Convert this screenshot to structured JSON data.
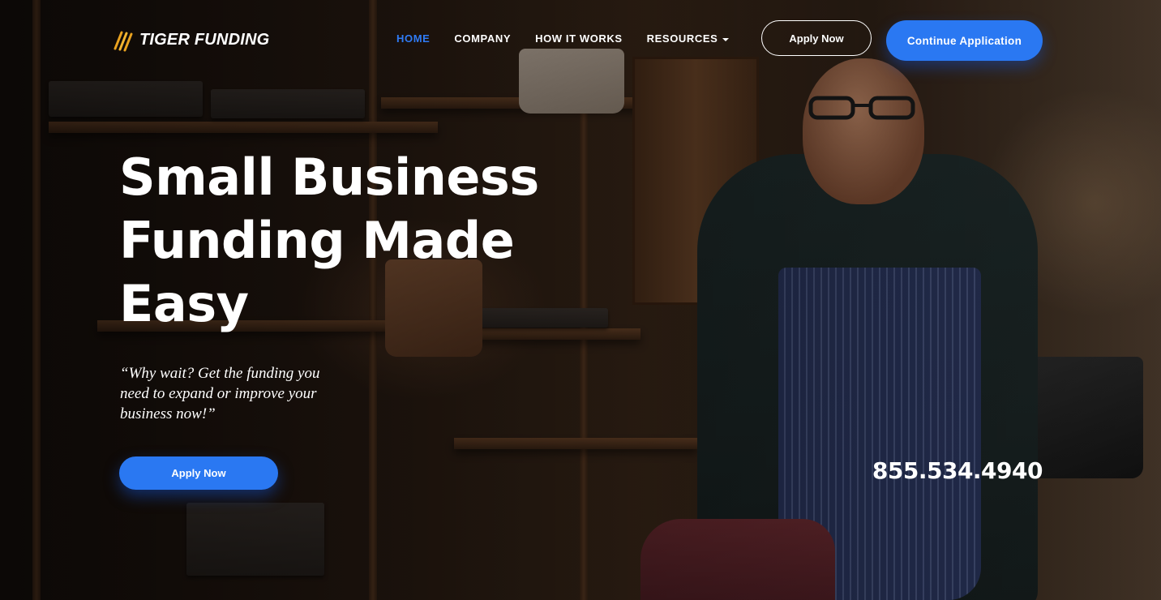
{
  "brand": {
    "name": "TIGER FUNDING",
    "accent": "#2a78f2",
    "logo_icon": "claw-marks-icon"
  },
  "nav": {
    "items": [
      {
        "label": "HOME",
        "active": true
      },
      {
        "label": "COMPANY",
        "active": false
      },
      {
        "label": "HOW IT WORKS",
        "active": false
      },
      {
        "label": "RESOURCES",
        "active": false,
        "has_dropdown": true
      }
    ],
    "apply_label": "Apply Now",
    "continue_label": "Continue Application"
  },
  "hero": {
    "headline": "Small Business Funding Made Easy",
    "quote": "“Why wait? Get the funding you need to expand or improve your business now!”",
    "cta_label": "Apply Now",
    "phone": "855.534.4940",
    "background_image": "smiling-shop-owner-photo"
  }
}
